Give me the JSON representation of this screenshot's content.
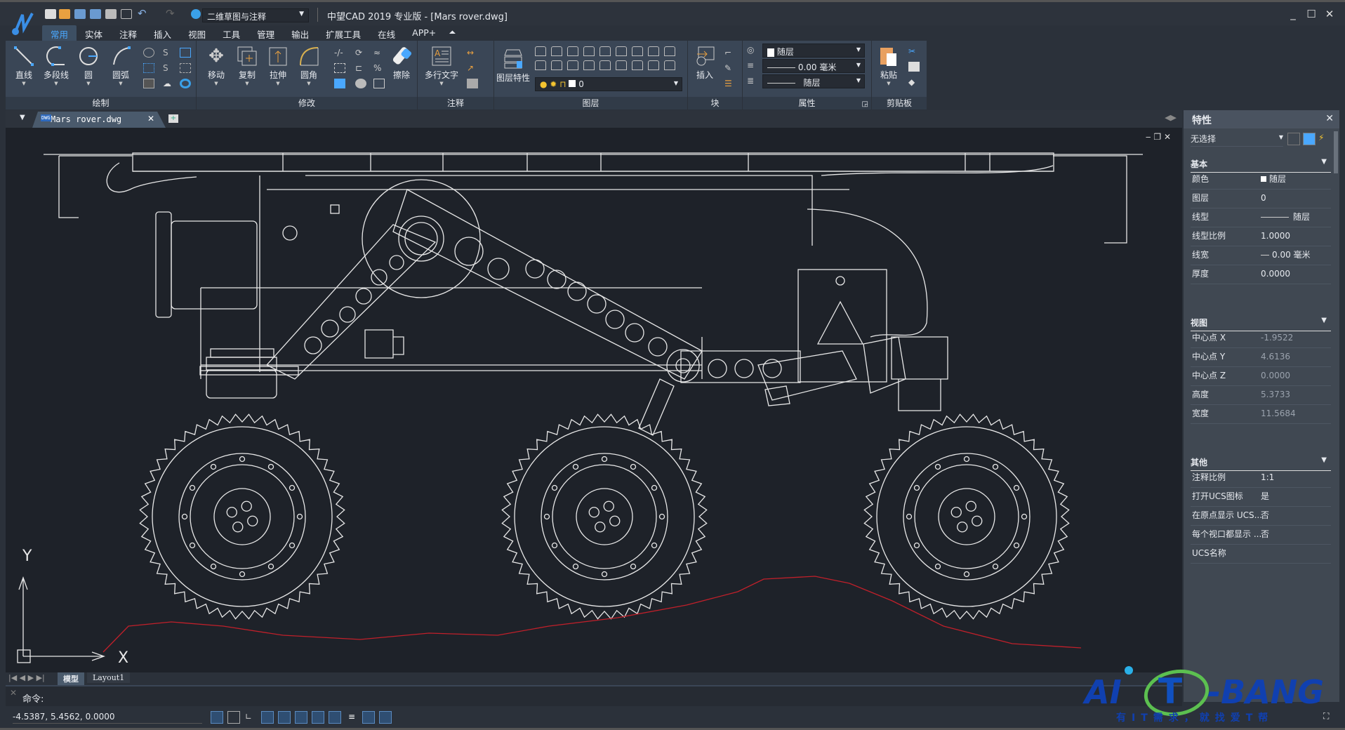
{
  "titlebar": {
    "workspace": "二维草图与注释",
    "title": "中望CAD 2019 专业版 - [Mars rover.dwg]"
  },
  "menu_tabs": [
    "常用",
    "实体",
    "注释",
    "插入",
    "视图",
    "工具",
    "管理",
    "输出",
    "扩展工具",
    "在线",
    "APP+"
  ],
  "ribbon": {
    "draw": {
      "label": "绘制",
      "tools": [
        "直线",
        "多段线",
        "圆",
        "圆弧"
      ]
    },
    "modify": {
      "label": "修改",
      "tools": [
        "移动",
        "复制",
        "拉伸",
        "圆角",
        "擦除"
      ]
    },
    "annotate": {
      "label": "注释",
      "tools": [
        "多行文字"
      ]
    },
    "layer": {
      "label": "图层",
      "tools": [
        "图层特性"
      ],
      "current_layer": "0"
    },
    "block": {
      "label": "块",
      "tools": [
        "插入"
      ]
    },
    "properties": {
      "label": "属性",
      "color": "随层",
      "lineweight": "0.00 毫米",
      "linetype": "随层"
    },
    "clipboard": {
      "label": "剪贴板",
      "tools": [
        "粘贴"
      ]
    }
  },
  "document_tab": {
    "name": "Mars rover.dwg"
  },
  "ucs": {
    "x": "X",
    "y": "Y"
  },
  "layout_tabs": [
    "模型",
    "Layout1"
  ],
  "command": {
    "prompt": "命令:"
  },
  "status": {
    "coordinates": "-4.5387, 5.4562, 0.0000"
  },
  "properties_panel": {
    "title": "特性",
    "selection": "无选择",
    "sections": [
      {
        "title": "基本",
        "rows": [
          [
            "颜色",
            "随层"
          ],
          [
            "图层",
            "0"
          ],
          [
            "线型",
            "随层"
          ],
          [
            "线型比例",
            "1.0000"
          ],
          [
            "线宽",
            "0.00 毫米"
          ],
          [
            "厚度",
            "0.0000"
          ]
        ]
      },
      {
        "title": "视图",
        "rows": [
          [
            "中心点 X",
            "-1.9522"
          ],
          [
            "中心点 Y",
            "4.6136"
          ],
          [
            "中心点 Z",
            "0.0000"
          ],
          [
            "高度",
            "5.3733"
          ],
          [
            "宽度",
            "11.5684"
          ]
        ]
      },
      {
        "title": "其他",
        "rows": [
          [
            "注释比例",
            "1:1"
          ],
          [
            "打开UCS图标",
            "是"
          ],
          [
            "在原点显示 UCS...",
            "否"
          ],
          [
            "每个视口都显示 ...",
            "否"
          ],
          [
            "UCS名称",
            ""
          ]
        ]
      }
    ]
  },
  "watermark": {
    "text": "AIT-BANG",
    "tagline": "有IT需求，就找爱T帮"
  },
  "colors": {
    "accent": "#4aa8ff",
    "canvas": "#1e2229",
    "terrain": "#c0202a",
    "ribbon": "#3a4656"
  }
}
